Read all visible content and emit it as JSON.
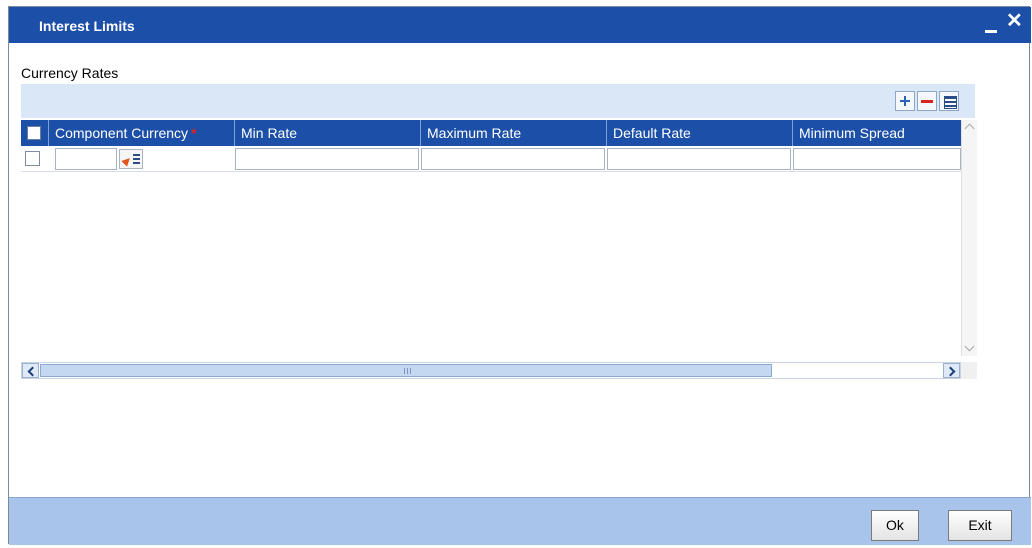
{
  "window": {
    "title": "Interest Limits",
    "minimize_label": "",
    "close_label": "✕"
  },
  "section": {
    "label": "Currency Rates"
  },
  "grid": {
    "columns": [
      {
        "label": "Component Currency",
        "required": true
      },
      {
        "label": "Min Rate",
        "required": false
      },
      {
        "label": "Maximum Rate",
        "required": false
      },
      {
        "label": "Default Rate",
        "required": false
      },
      {
        "label": "Minimum Spread",
        "required": false
      }
    ],
    "required_marker": "*",
    "rows": [
      {
        "component_currency": "",
        "min_rate": "",
        "maximum_rate": "",
        "default_rate": "",
        "minimum_spread": ""
      }
    ]
  },
  "footer": {
    "ok_label": "Ok",
    "exit_label": "Exit"
  },
  "colors": {
    "title_bar": "#1c4fa8",
    "grid_toolbar": "#d9e7f7",
    "footer": "#a8c4eb",
    "required": "#e2231a"
  }
}
